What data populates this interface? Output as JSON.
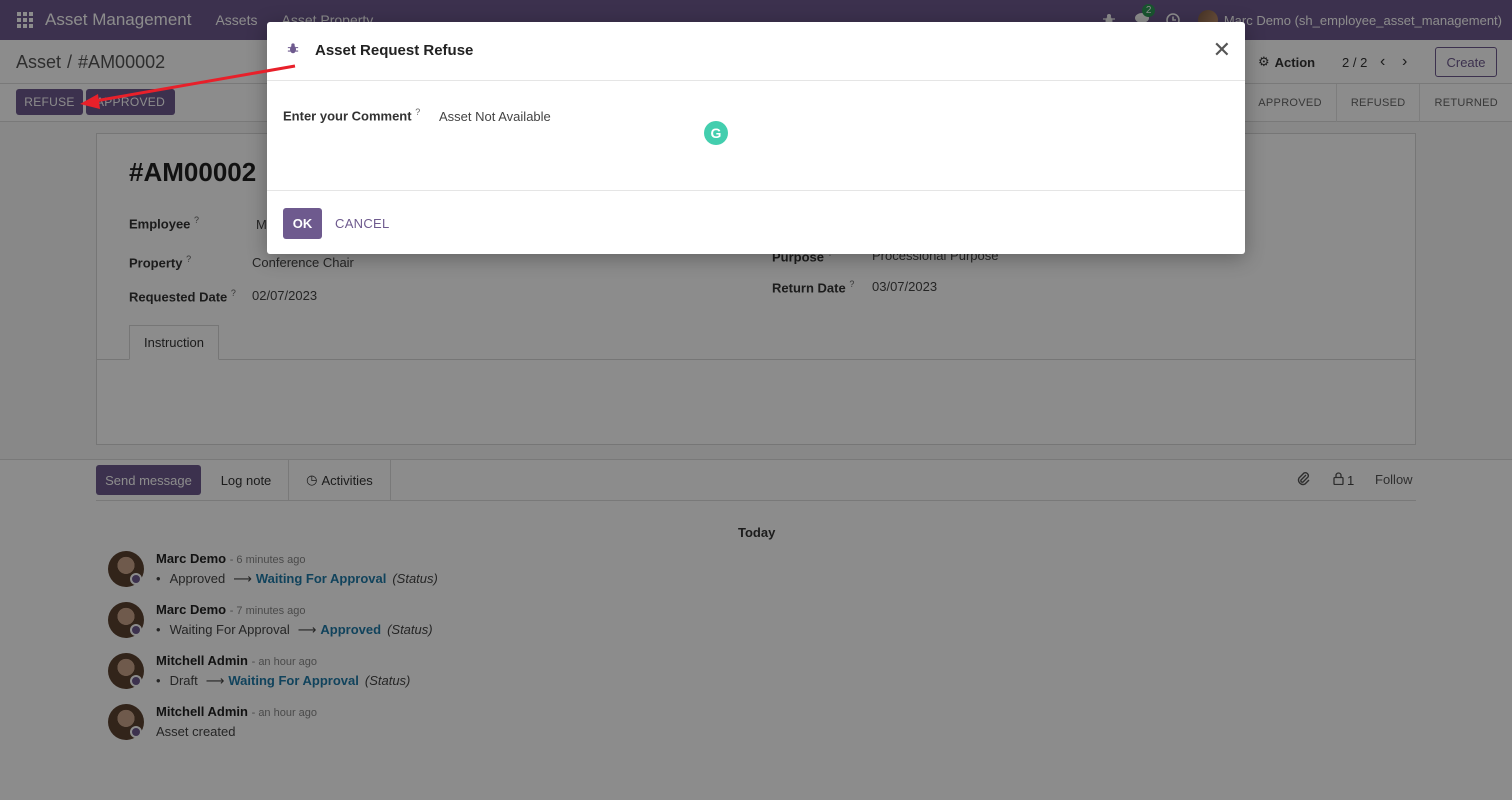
{
  "navbar": {
    "app_title": "Asset Management",
    "menus": [
      "Assets",
      "Asset Property"
    ],
    "chat_count": "2",
    "user": "Marc Demo (sh_employee_asset_management)"
  },
  "control": {
    "breadcrumb_parent": "Asset",
    "breadcrumb_sep": "/",
    "breadcrumb_current": "#AM00002",
    "action_label": "Action",
    "pager": "2 / 2",
    "create_label": "Create"
  },
  "statusbar": {
    "refuse_label": "REFUSE",
    "approved_label": "APPROVED",
    "stages": [
      "APPROVED",
      "REFUSED",
      "RETURNED"
    ]
  },
  "form": {
    "record_name": "#AM00002",
    "employee_label": "Employee",
    "employee_value": "M",
    "property_label": "Property",
    "property_value": "Conference Chair",
    "requested_date_label": "Requested Date",
    "requested_date_value": "02/07/2023",
    "purpose_label": "Purpose",
    "purpose_value": "Processional Purpose",
    "return_date_label": "Return Date",
    "return_date_value": "03/07/2023",
    "help_mark": "?",
    "tab_instruction": "Instruction"
  },
  "chatter": {
    "send_message": "Send message",
    "log_note": "Log note",
    "activities": "Activities",
    "followers_count": "1",
    "follow": "Follow",
    "today": "Today",
    "messages": [
      {
        "author": "Marc Demo",
        "ago": "- 6 minutes ago",
        "old": "Approved",
        "new": "Waiting For Approval",
        "field": "(Status)"
      },
      {
        "author": "Marc Demo",
        "ago": "- 7 minutes ago",
        "old": "Waiting For Approval",
        "new": "Approved",
        "field": "(Status)"
      },
      {
        "author": "Mitchell Admin",
        "ago": "- an hour ago",
        "old": "Draft",
        "new": "Waiting For Approval",
        "field": "(Status)"
      },
      {
        "author": "Mitchell Admin",
        "ago": "- an hour ago",
        "text": "Asset created"
      }
    ]
  },
  "modal": {
    "title": "Asset Request Refuse",
    "comment_label": "Enter your Comment",
    "comment_value": "Asset Not Available",
    "ok_label": "OK",
    "cancel_label": "CANCEL"
  },
  "colors": {
    "brand": "#6e5a8e",
    "annotation_arrow": "#e8202a",
    "link": "#1f7aa8"
  },
  "icons": [
    "apps-icon",
    "bug-icon",
    "chat-icon",
    "clock-icon",
    "gear-icon",
    "chevron-left-icon",
    "chevron-right-icon",
    "close-icon",
    "paperclip-icon",
    "lock-icon",
    "grammarly-icon"
  ]
}
